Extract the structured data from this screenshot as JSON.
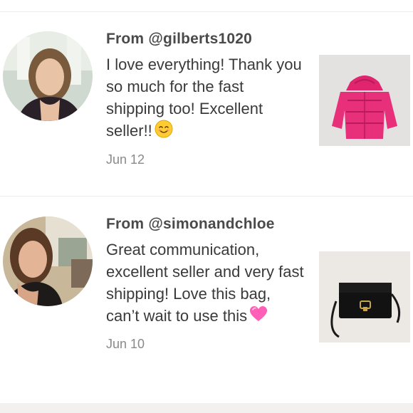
{
  "reviews": [
    {
      "from_prefix": "From",
      "handle": "@gilberts1020",
      "message": "I love everything! Thank you so much for the fast shipping too! Excellent seller!!",
      "emoji": "smiling-face-emoji",
      "date": "Jun 12",
      "item_icon": "pink-puffer-jacket-photo"
    },
    {
      "from_prefix": "From",
      "handle": "@simonandchloe",
      "message": "Great communication, excellent seller and very fast shipping! Love this bag, can’t wait to use this",
      "emoji": "pink-heart-emoji",
      "date": "Jun 10",
      "item_icon": "black-handbag-photo"
    }
  ],
  "colors": {
    "text": "#3a3a3a",
    "handle": "#4a4a4a",
    "date": "#8a8a8a",
    "divider": "#ececec"
  }
}
